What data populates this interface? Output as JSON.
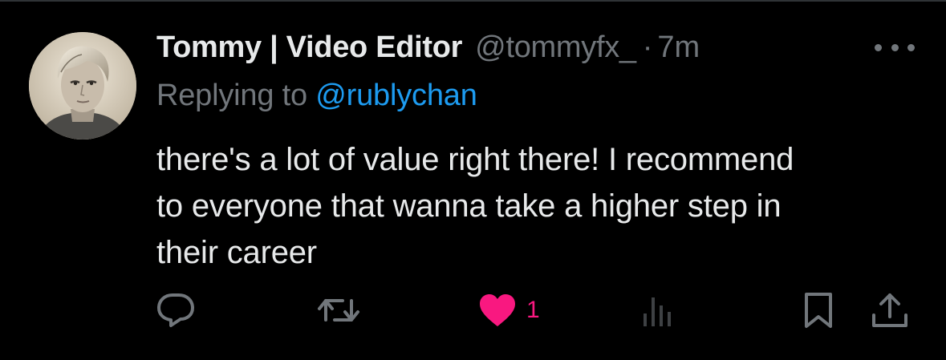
{
  "tweet": {
    "author": {
      "display_name": "Tommy | Video Editor",
      "handle": "@tommyfx_",
      "avatar": "portrait-avatar"
    },
    "separator": "·",
    "time": "7m",
    "reply_prefix": "Replying to",
    "reply_to": "@rublychan",
    "text_lines": [
      "there's a lot of value right there! I recommend",
      "to everyone that wanna take a higher step in",
      "their career"
    ]
  },
  "actions": {
    "reply": {
      "icon": "reply-icon"
    },
    "retweet": {
      "icon": "retweet-icon"
    },
    "like": {
      "icon": "heart-icon",
      "count": "1",
      "liked": true
    },
    "views": {
      "icon": "analytics-icon"
    },
    "bookmark": {
      "icon": "bookmark-icon"
    },
    "share": {
      "icon": "share-icon"
    }
  },
  "menu": {
    "icon": "more-icon"
  },
  "colors": {
    "background": "#000000",
    "text": "#e7e9ea",
    "muted": "#71767b",
    "link": "#1d9bf0",
    "like": "#f91880",
    "views_icon": "#3e4144"
  }
}
